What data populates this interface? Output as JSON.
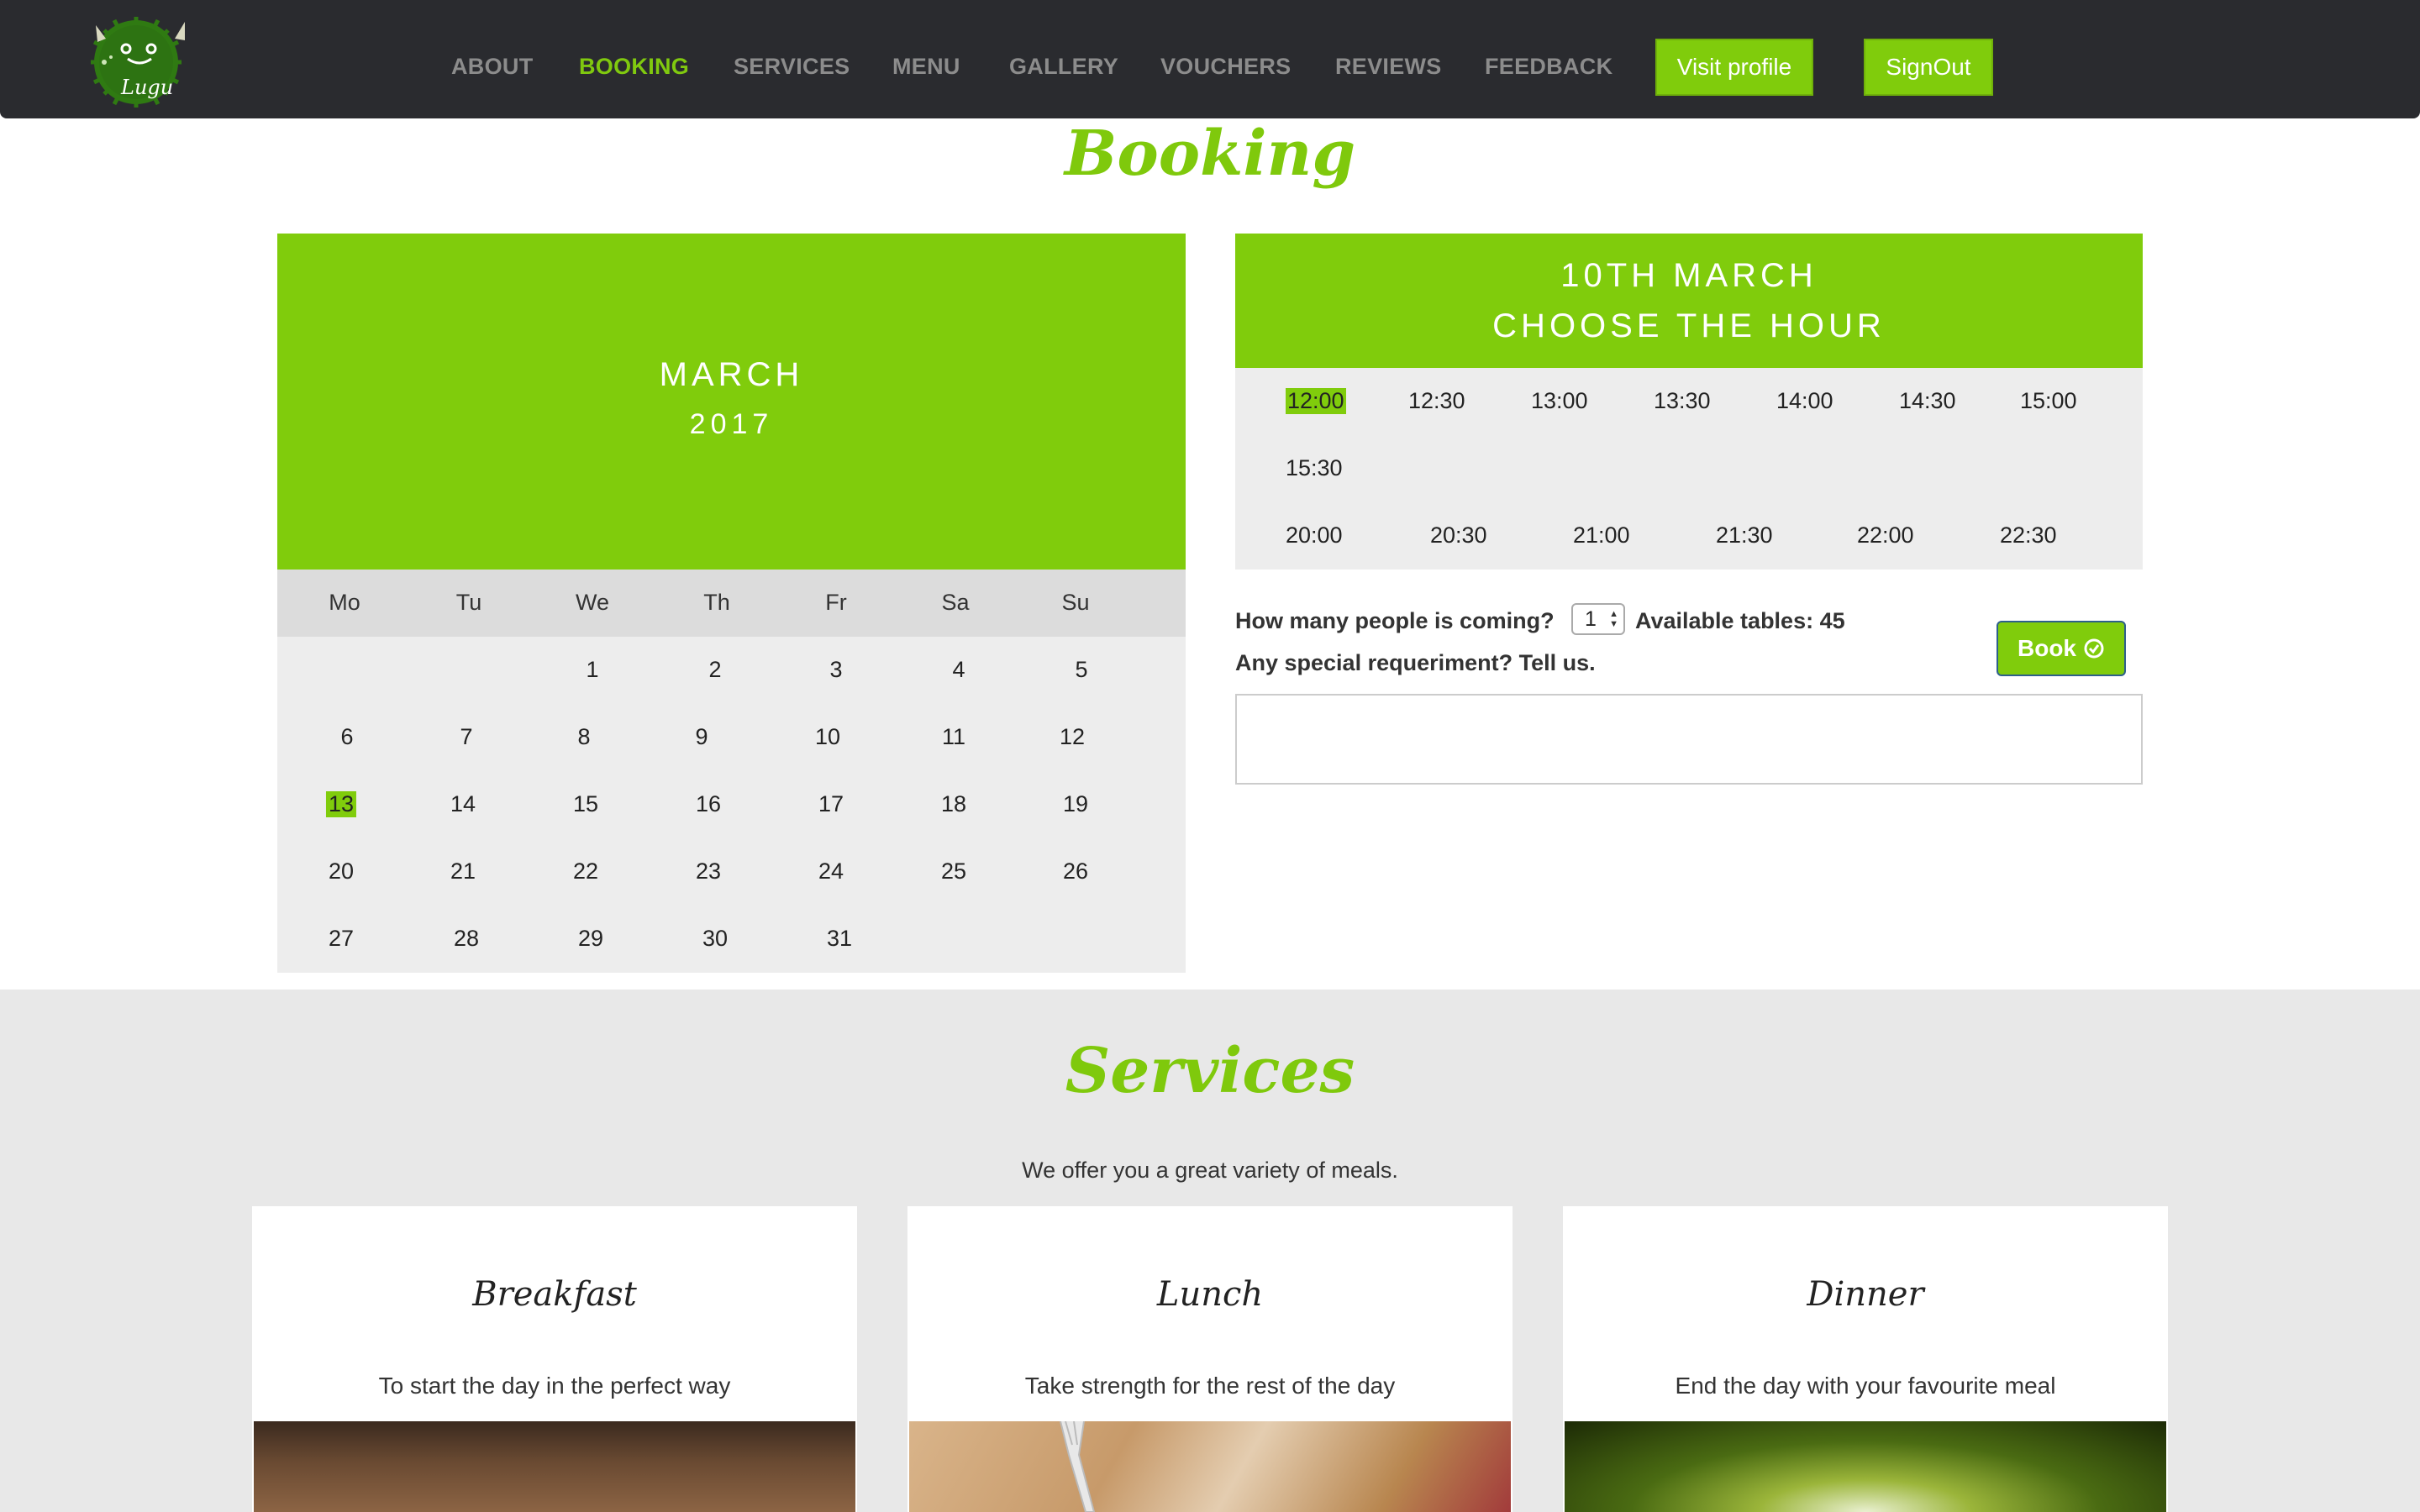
{
  "nav": {
    "items": [
      {
        "label": "ABOUT",
        "active": false
      },
      {
        "label": "BOOKING",
        "active": true
      },
      {
        "label": "SERVICES",
        "active": false
      },
      {
        "label": "MENU",
        "active": false
      },
      {
        "label": "GALLERY",
        "active": false
      },
      {
        "label": "VOUCHERS",
        "active": false
      },
      {
        "label": "REVIEWS",
        "active": false
      },
      {
        "label": "FEEDBACK",
        "active": false
      }
    ],
    "visit_profile": "Visit profile",
    "sign_out": "SignOut",
    "logo_text": "Lugu"
  },
  "booking": {
    "title": "Booking",
    "calendar": {
      "month": "MARCH",
      "year": "2017",
      "weekdays": [
        "Mo",
        "Tu",
        "We",
        "Th",
        "Fr",
        "Sa",
        "Su"
      ],
      "weeks": [
        [
          "",
          "",
          "1",
          "2",
          "3",
          "4",
          "5"
        ],
        [
          "6",
          "7",
          "8",
          "9",
          "10",
          "11",
          "12"
        ],
        [
          "13",
          "14",
          "15",
          "16",
          "17",
          "18",
          "19"
        ],
        [
          "20",
          "21",
          "22",
          "23",
          "24",
          "25",
          "26"
        ],
        [
          "27",
          "28",
          "29",
          "30",
          "31",
          "",
          ""
        ]
      ],
      "selected_day": "13"
    },
    "hours": {
      "title_line1": "10TH MARCH",
      "title_line2": "CHOOSE THE HOUR",
      "lunch_slots": [
        "12:00",
        "12:30",
        "13:00",
        "13:30",
        "14:00",
        "14:30",
        "15:00",
        "15:30"
      ],
      "dinner_slots": [
        "20:00",
        "20:30",
        "21:00",
        "21:30",
        "22:00",
        "22:30"
      ],
      "selected_slot": "12:00"
    },
    "people_label": "How many people is coming?",
    "people_value": "1",
    "available_label": "Available tables: 45",
    "special_label": "Any special requeriment? Tell us.",
    "book_label": "Book",
    "textarea_value": ""
  },
  "services": {
    "title": "Services",
    "subtitle": "We offer you a great variety of meals.",
    "cards": [
      {
        "title": "Breakfast",
        "desc": "To start the day in the perfect way"
      },
      {
        "title": "Lunch",
        "desc": "Take strength for the rest of the day"
      },
      {
        "title": "Dinner",
        "desc": "End the day with your favourite meal"
      }
    ]
  },
  "colors": {
    "accent": "#80cc0c",
    "nav_bg": "#2a2b2f",
    "panel_bg": "#ededed"
  }
}
